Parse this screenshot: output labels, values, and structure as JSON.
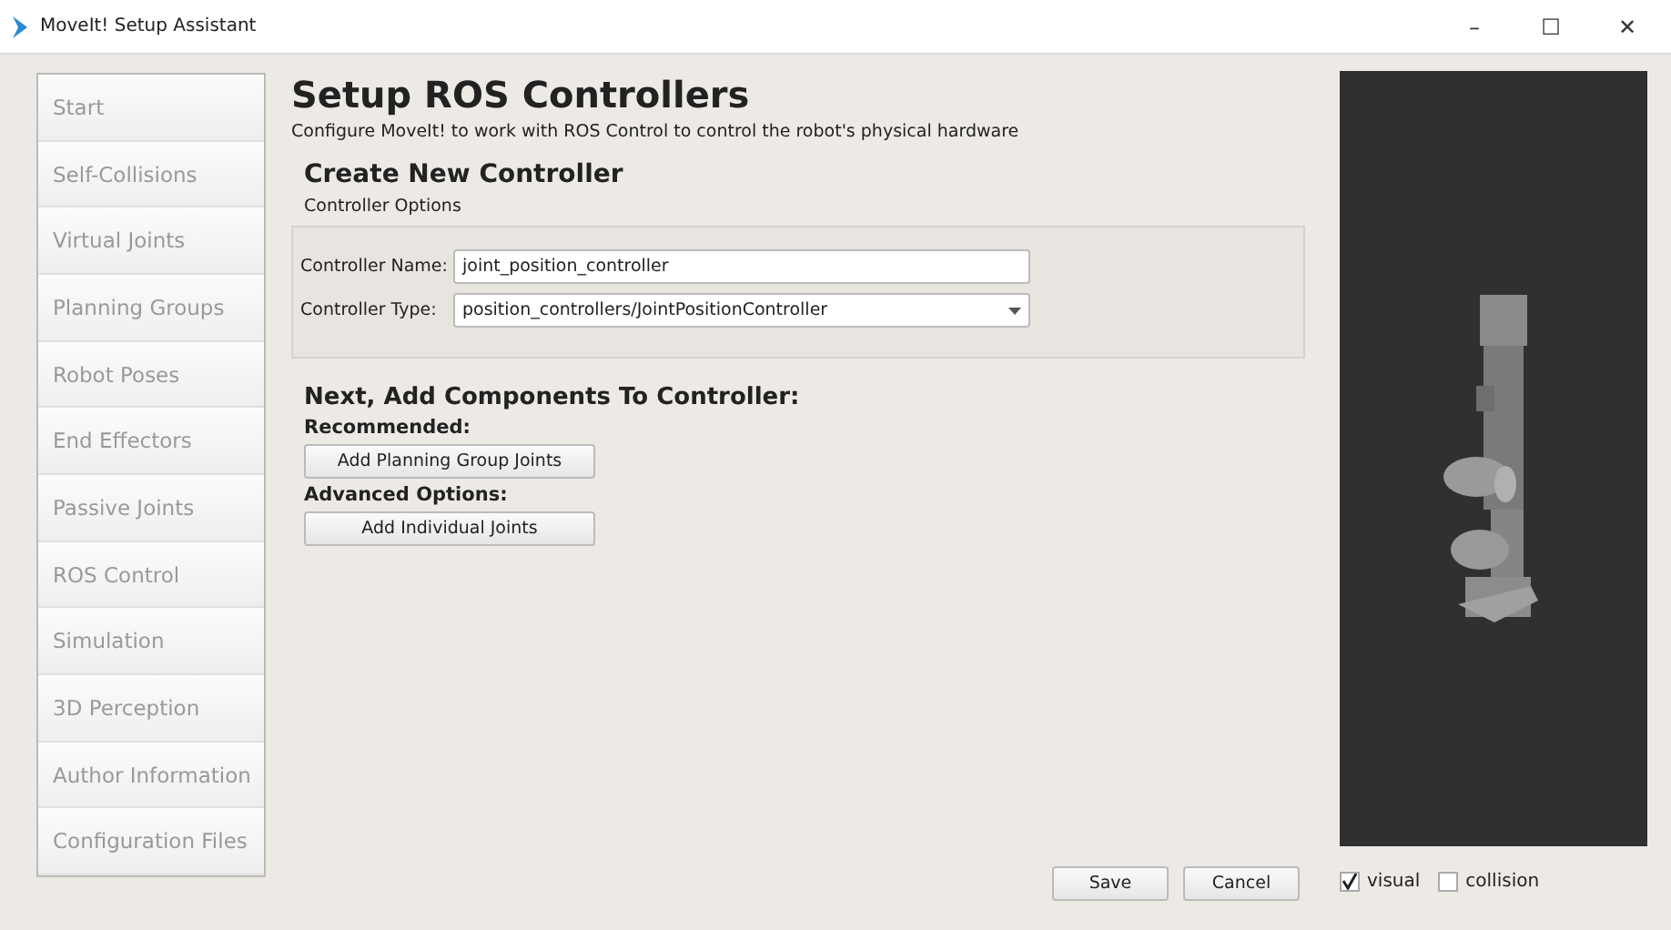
{
  "window": {
    "title": "MoveIt! Setup Assistant",
    "controls": [
      "–",
      "☐",
      "✕"
    ]
  },
  "sidebar": {
    "items": [
      {
        "label": "Start"
      },
      {
        "label": "Self-Collisions"
      },
      {
        "label": "Virtual Joints"
      },
      {
        "label": "Planning Groups"
      },
      {
        "label": "Robot Poses"
      },
      {
        "label": "End Effectors"
      },
      {
        "label": "Passive Joints"
      },
      {
        "label": "ROS Control"
      },
      {
        "label": "Simulation"
      },
      {
        "label": "3D Perception"
      },
      {
        "label": "Author Information"
      },
      {
        "label": "Configuration Files"
      }
    ]
  },
  "page": {
    "title": "Setup ROS Controllers",
    "description": "Configure MoveIt! to work with ROS Control to control the robot's physical hardware",
    "section_title": "Create New Controller",
    "group_title": "Controller Options",
    "fields": [
      {
        "kind": "text",
        "label": "Controller Name:",
        "value": "joint_position_controller"
      },
      {
        "kind": "dropdown",
        "label": "Controller Type:",
        "value": "position_controllers/JointPositionController"
      }
    ],
    "components_title": "Next, Add Components To Controller:",
    "component_groups": [
      {
        "label": "Recommended:",
        "button": "Add Planning Group Joints"
      },
      {
        "label": "Advanced Options:",
        "button": "Add Individual Joints"
      }
    ],
    "buttons": [
      "Save",
      "Cancel"
    ]
  },
  "viewer": {
    "checkboxes": [
      {
        "label": "visual",
        "checked": true
      },
      {
        "label": "collision",
        "checked": false
      }
    ]
  }
}
